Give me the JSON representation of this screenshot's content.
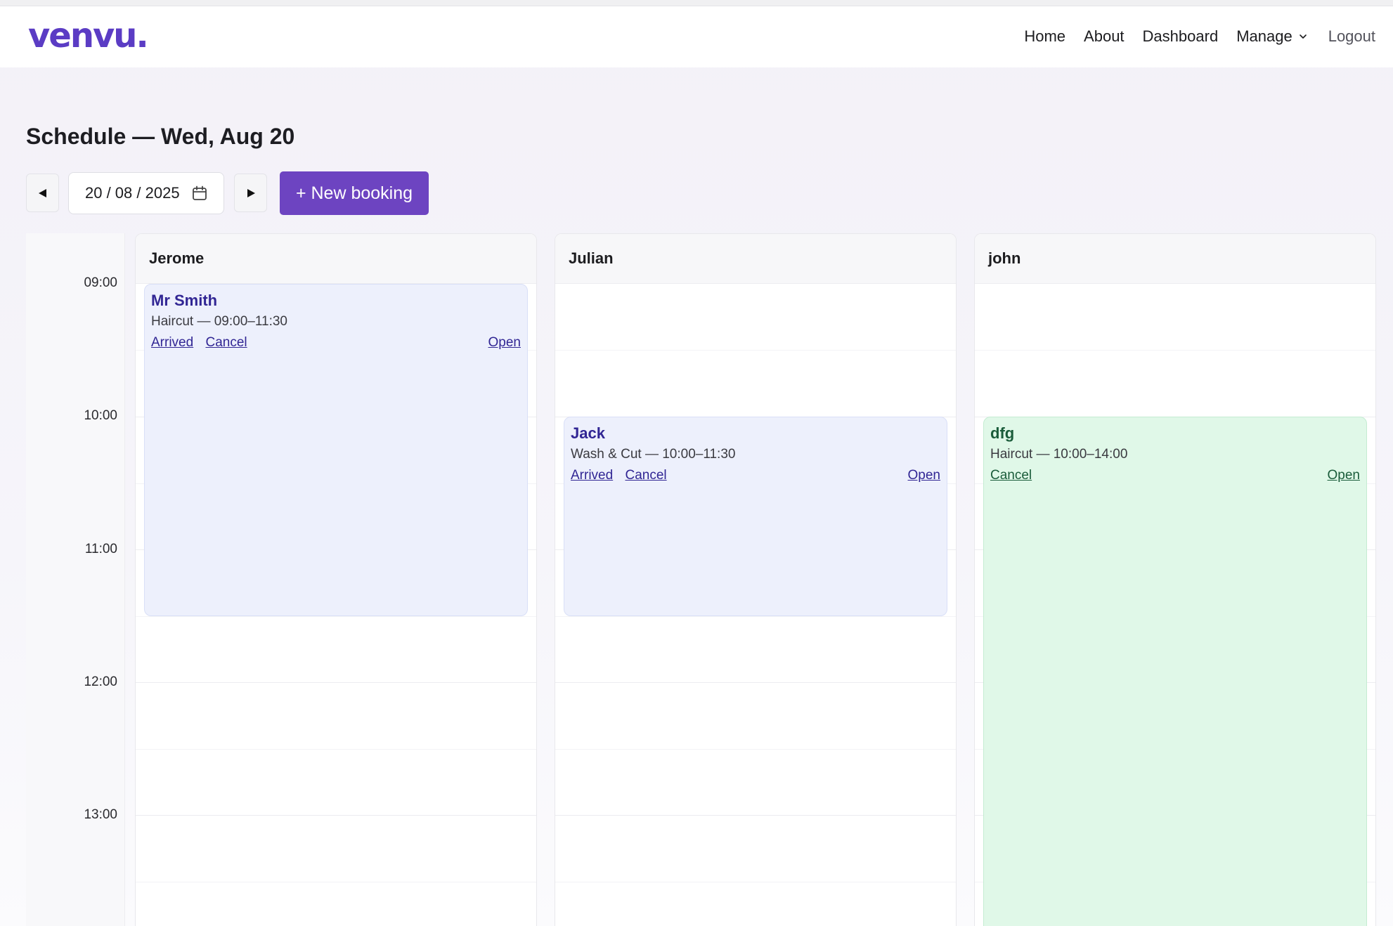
{
  "brand": {
    "logo": "venvu."
  },
  "nav": {
    "home": "Home",
    "about": "About",
    "dashboard": "Dashboard",
    "manage": "Manage",
    "logout": "Logout"
  },
  "page": {
    "title": "Schedule — Wed, Aug 20"
  },
  "toolbar": {
    "prev_label": "◀",
    "next_label": "▶",
    "date_value": "20 / 08 / 2025",
    "new_booking_label": "+ New booking"
  },
  "times": [
    "09:00",
    "10:00",
    "11:00",
    "12:00",
    "13:00"
  ],
  "staff": [
    {
      "name": "Jerome",
      "bookings": [
        {
          "client": "Mr Smith",
          "detail": "Haircut — 09:00–11:30",
          "arrived_label": "Arrived",
          "cancel_label": "Cancel",
          "open_label": "Open"
        }
      ]
    },
    {
      "name": "Julian",
      "bookings": [
        {
          "client": "Jack",
          "detail": "Wash & Cut — 10:00–11:30",
          "arrived_label": "Arrived",
          "cancel_label": "Cancel",
          "open_label": "Open"
        }
      ]
    },
    {
      "name": "john",
      "bookings": [
        {
          "client": "dfg",
          "detail": "Haircut — 10:00–14:00",
          "cancel_label": "Cancel",
          "open_label": "Open"
        }
      ]
    }
  ],
  "colors": {
    "brand": "#5b3cc4",
    "primary_button": "#6d44c1",
    "booking_blue_bg": "#edf0fc",
    "booking_green_bg": "#e0f8e8",
    "booking_blue_text": "#312694",
    "booking_green_text": "#1a5c3a"
  }
}
